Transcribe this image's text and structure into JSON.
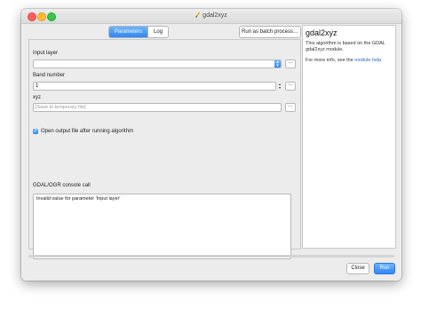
{
  "window": {
    "title": "gdal2xyz"
  },
  "tabs": [
    {
      "label": "Parameters",
      "active": true
    },
    {
      "label": "Log",
      "active": false
    }
  ],
  "toolbar": {
    "batch_label": "Run as batch process…"
  },
  "params": {
    "input_layer": {
      "label": "Input layer",
      "value": ""
    },
    "band_number": {
      "label": "Band number",
      "value": "1"
    },
    "xyz": {
      "label": "xyz",
      "placeholder": "[Save to temporary file]"
    },
    "open_output": {
      "label": "Open output file after running algorithm",
      "checked": true
    },
    "ellipsis": "…"
  },
  "console": {
    "label": "GDAL/OGR console call",
    "text": "Invalid value for parameter 'Input layer'"
  },
  "help": {
    "title": "gdal2xyz",
    "description": "This algorithm is based on the GDAL gdal2xyz module.",
    "more_prefix": "For more info, see the",
    "more_link": "module help"
  },
  "buttons": {
    "close": "Close",
    "run": "Run"
  },
  "colors": {
    "accent": "#2f86f6",
    "link": "#2a64c5",
    "close": "#fc5f57",
    "minimize": "#fdbc2e",
    "maximize": "#33c748"
  },
  "icons": {
    "title_icon": "gdal-brush-icon",
    "combo": "chevron-updown-icon",
    "spin": "spin-arrows-icon",
    "check": "checkmark-icon"
  }
}
